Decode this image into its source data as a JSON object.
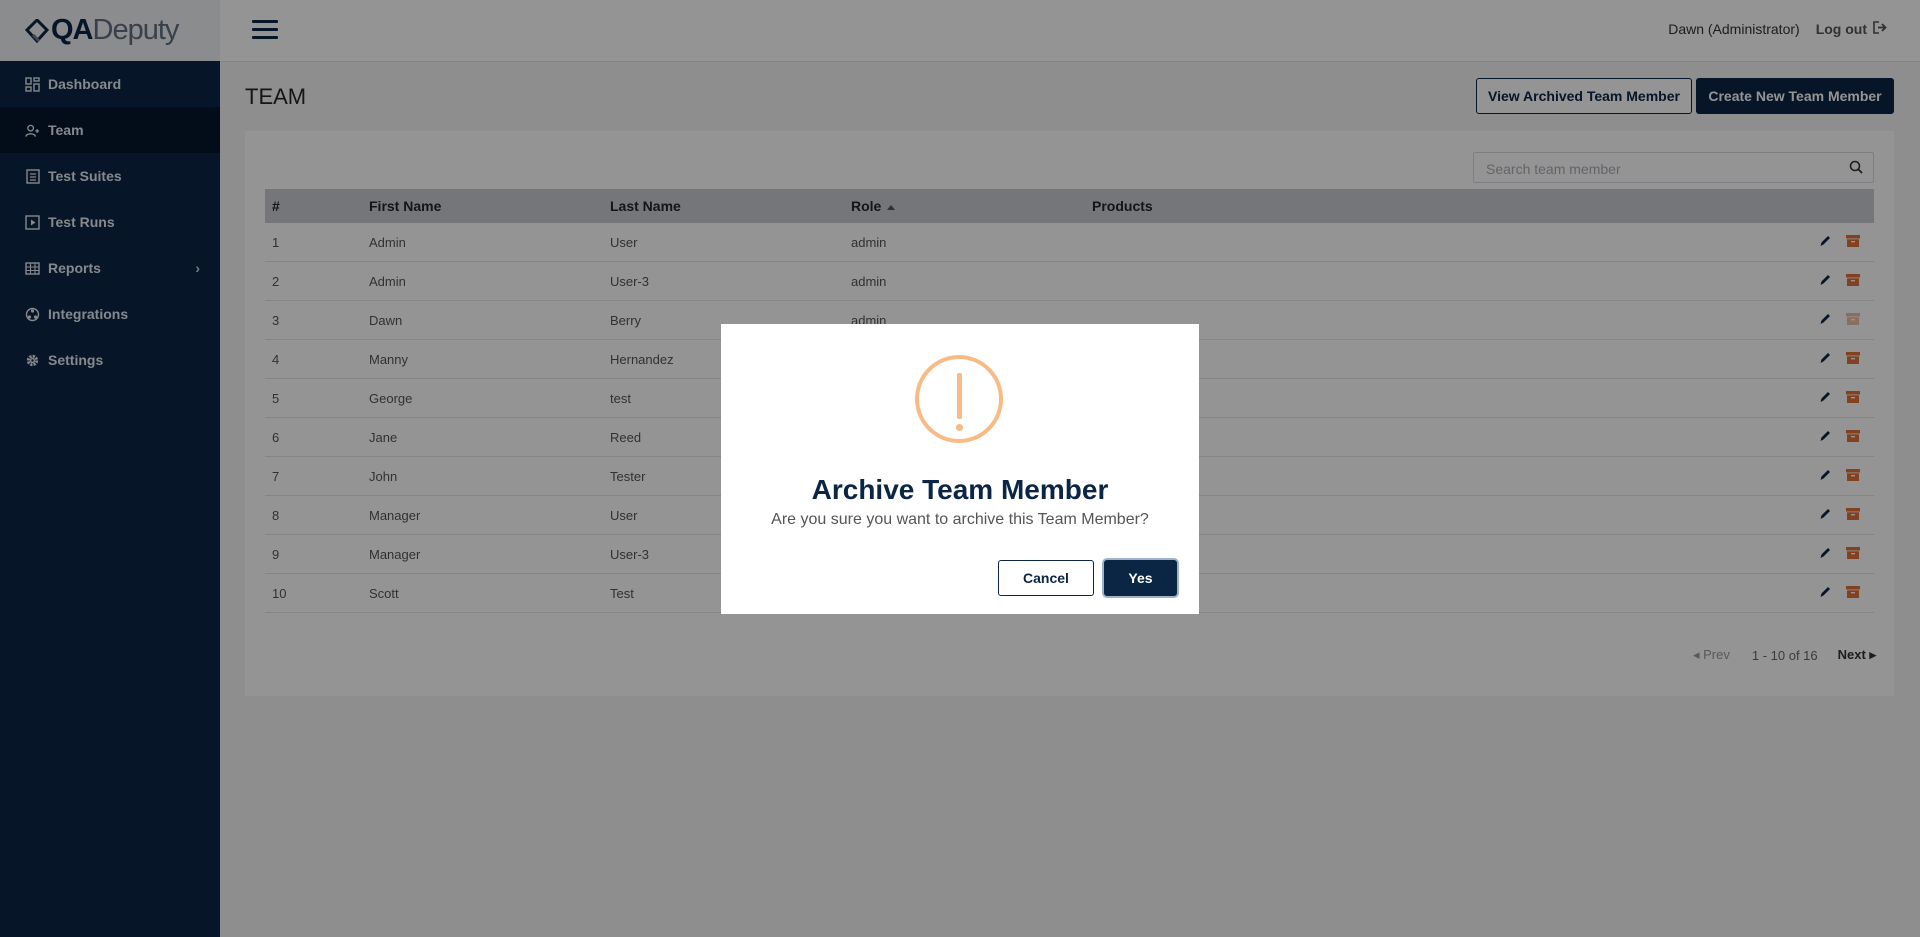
{
  "app": {
    "logo_qa": "QA",
    "logo_deputy": "Deputy"
  },
  "sidebar": {
    "items": [
      {
        "label": "Dashboard",
        "icon": "dashboard-icon"
      },
      {
        "label": "Team",
        "icon": "team-icon",
        "active": true
      },
      {
        "label": "Test Suites",
        "icon": "test-suites-icon"
      },
      {
        "label": "Test Runs",
        "icon": "test-runs-icon"
      },
      {
        "label": "Reports",
        "icon": "reports-icon",
        "has_submenu": true
      },
      {
        "label": "Integrations",
        "icon": "integrations-icon"
      },
      {
        "label": "Settings",
        "icon": "gear-icon"
      }
    ]
  },
  "header": {
    "user_name": "Dawn",
    "user_role": "(Administrator)",
    "logout_label": "Log out"
  },
  "page": {
    "title": "TEAM",
    "view_archived_label": "View Archived Team Member",
    "create_label": "Create New Team Member",
    "search_placeholder": "Search team member"
  },
  "table": {
    "columns": {
      "num": "#",
      "first": "First Name",
      "last": "Last Name",
      "role": "Role",
      "products": "Products"
    },
    "rows": [
      {
        "num": "1",
        "first": "Admin",
        "last": "User",
        "role": "admin",
        "products": ""
      },
      {
        "num": "2",
        "first": "Admin",
        "last": "User-3",
        "role": "admin",
        "products": ""
      },
      {
        "num": "3",
        "first": "Dawn",
        "last": "Berry",
        "role": "admin",
        "products": ""
      },
      {
        "num": "4",
        "first": "Manny",
        "last": "Hernandez",
        "role": "",
        "products": ""
      },
      {
        "num": "5",
        "first": "George",
        "last": "test",
        "role": "",
        "products": ""
      },
      {
        "num": "6",
        "first": "Jane",
        "last": "Reed",
        "role": "",
        "products": ""
      },
      {
        "num": "7",
        "first": "John",
        "last": "Tester",
        "role": "",
        "products": ""
      },
      {
        "num": "8",
        "first": "Manager",
        "last": "User",
        "role": "",
        "products": ""
      },
      {
        "num": "9",
        "first": "Manager",
        "last": "User-3",
        "role": "",
        "products": ""
      },
      {
        "num": "10",
        "first": "Scott",
        "last": "Test",
        "role": "",
        "products": ""
      }
    ]
  },
  "pagination": {
    "prev_label": "Prev",
    "info": "1 - 10 of 16",
    "next_label": "Next"
  },
  "modal": {
    "title": "Archive Team Member",
    "message": "Are you sure you want to archive this Team Member?",
    "cancel_label": "Cancel",
    "yes_label": "Yes"
  },
  "colors": {
    "navy": "#0b2544",
    "warning": "#f8bb86",
    "archive": "#e0713a"
  }
}
